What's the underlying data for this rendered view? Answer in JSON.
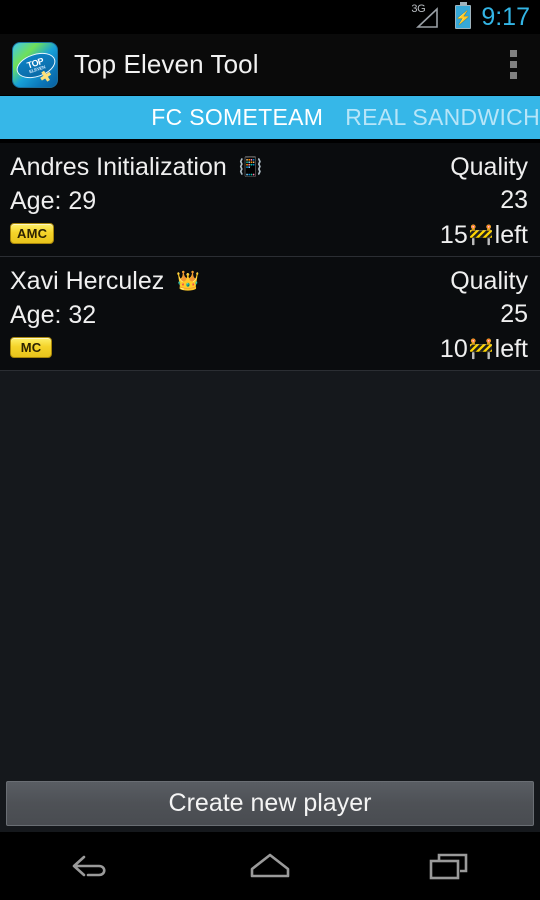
{
  "statusbar": {
    "network_label": "3G",
    "network_icon": "signal-triangle-icon",
    "battery_icon": "battery-charging-icon",
    "battery_bolt": "⚡",
    "clock": "9:17",
    "clock_color": "#33b5e5"
  },
  "actionbar": {
    "app_icon_name": "top-eleven-app-icon",
    "app_icon_text_top": "TOP",
    "app_icon_text_bottom": "ELEVEN",
    "title": "Top Eleven Tool",
    "overflow_icon": "overflow-menu-icon"
  },
  "tabs": {
    "background_color": "#36b7e8",
    "items": [
      {
        "label": "FC SOMETEAM",
        "selected": true
      },
      {
        "label": "REAL SANDWICH",
        "selected": false
      }
    ]
  },
  "list": {
    "quality_label": "Quality",
    "left_suffix": "left",
    "age_prefix": "Age: ",
    "cone_icon": "traffic-cone-icon",
    "cone_glyph": "🚧",
    "players": [
      {
        "name": "Andres Initialization",
        "flag_icon": "whistle-icon",
        "flag_glyph": "📳",
        "age": "Age: 29",
        "position": "AMC",
        "quality_label": "Quality",
        "quality_value": "23",
        "rests_value": "15",
        "rests_suffix": "left"
      },
      {
        "name": "Xavi Herculez",
        "flag_icon": "crown-medal-icon",
        "flag_glyph": "👑",
        "age": "Age: 32",
        "position": "MC",
        "quality_label": "Quality",
        "quality_value": "25",
        "rests_value": "10",
        "rests_suffix": "left"
      }
    ]
  },
  "footer": {
    "create_button_label": "Create new player"
  },
  "navbar": {
    "back_icon": "back-arrow-icon",
    "home_icon": "home-icon",
    "recents_icon": "recent-apps-icon"
  },
  "colors": {
    "tab_accent": "#36b7e8",
    "row_background": "#0a0c0e",
    "page_background": "#15181c",
    "badge_yellow": "#f5d42a",
    "button_gray": "#4e5156"
  }
}
